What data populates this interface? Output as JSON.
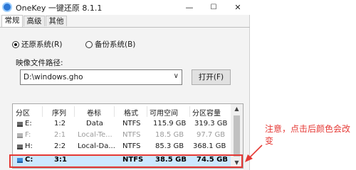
{
  "window": {
    "title": "OneKey 一键还原 8.1.1",
    "minimize": "—",
    "maximize": "☐",
    "close": "✕",
    "icon": "onekey-app-icon"
  },
  "tabs": [
    "常规",
    "高级",
    "其他"
  ],
  "mode": {
    "restore_label": "还原系统(R)",
    "backup_label": "备份系统(B)",
    "selected": "restore"
  },
  "image_path": {
    "label": "映像文件路径:",
    "value": "D:\\windows.gho",
    "open_button": "打开(F)"
  },
  "partition_table": {
    "columns": [
      "分区",
      "序列",
      "卷标",
      "格式",
      "可用空间",
      "分区容量"
    ],
    "rows": [
      {
        "drive": "E:",
        "seq": "1:2",
        "label": "Data",
        "fs": "NTFS",
        "free": "115.9 GB",
        "size": "319.3 GB",
        "state": "normal"
      },
      {
        "drive": "F:",
        "seq": "2:1",
        "label": "Local-Te...",
        "fs": "NTFS",
        "free": "18.5 GB",
        "size": "97.7 GB",
        "state": "dim"
      },
      {
        "drive": "H:",
        "seq": "2:2",
        "label": "Local-Da...",
        "fs": "NTFS",
        "free": "85.3 GB",
        "size": "368.1 GB",
        "state": "normal"
      },
      {
        "drive": "C:",
        "seq": "3:1",
        "label": "",
        "fs": "NTFS",
        "free": "38.5 GB",
        "size": "74.5 GB",
        "state": "selected"
      }
    ]
  },
  "annotation": {
    "text": "注意，点击后颜色会改变",
    "color": "#e53935"
  },
  "colors": {
    "selected_row": "#cce8ff",
    "highlight": "#e53935"
  }
}
